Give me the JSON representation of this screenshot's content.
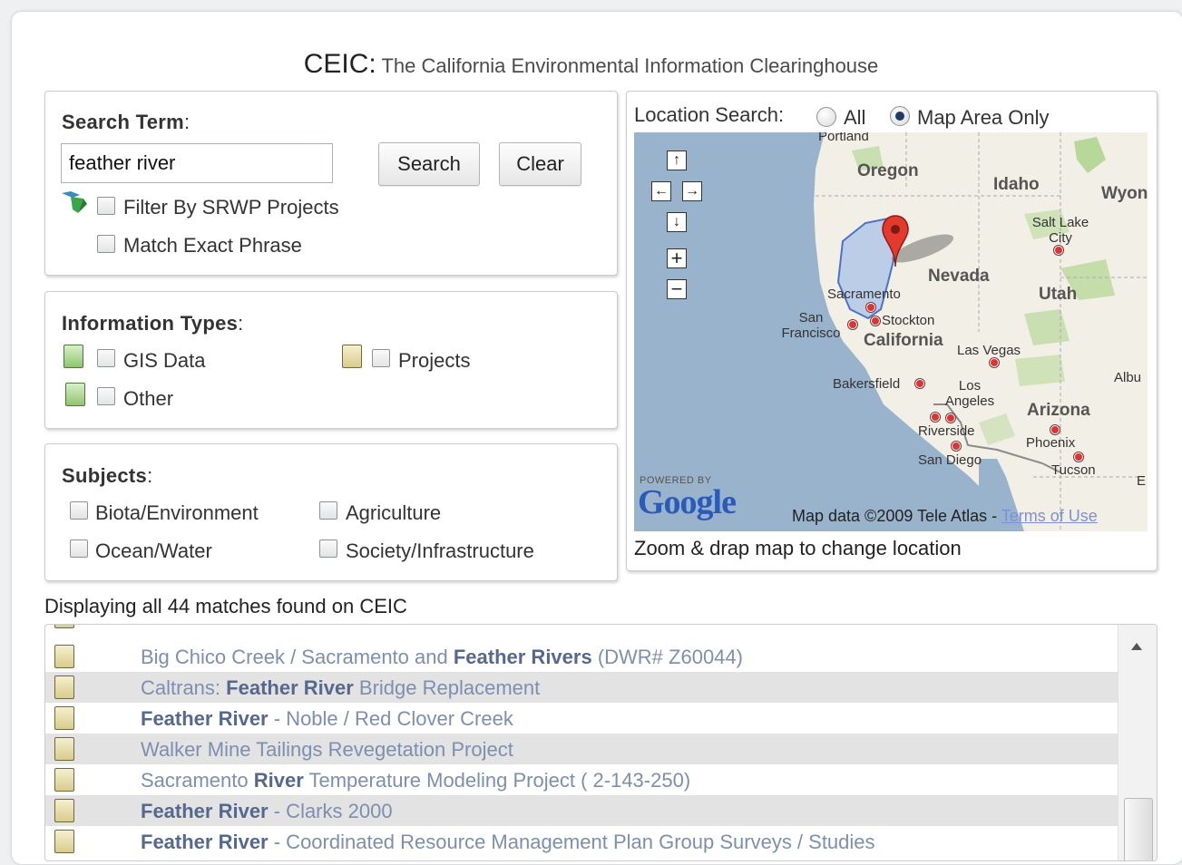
{
  "header": {
    "brand": "CEIC:",
    "subtitle": "The California Environmental Information Clearinghouse"
  },
  "search": {
    "heading": "Search Term",
    "value": "feather river",
    "search_button": "Search",
    "clear_button": "Clear",
    "filter_srwp_label": "Filter By SRWP Projects",
    "match_exact_label": "Match Exact Phrase"
  },
  "info_types": {
    "heading": "Information Types",
    "gis_label": "GIS Data",
    "projects_label": "Projects",
    "other_label": "Other"
  },
  "subjects": {
    "heading": "Subjects",
    "biota_label": "Biota/Environment",
    "agriculture_label": "Agriculture",
    "ocean_label": "Ocean/Water",
    "society_label": "Society/Infrastructure"
  },
  "location": {
    "label": "Location Search:",
    "all_label": "All",
    "map_area_label": "Map Area Only",
    "selected": "Map Area Only",
    "hint": "Zoom & drap map to change location"
  },
  "map": {
    "states": [
      "Oregon",
      "Idaho",
      "Wyon",
      "Nevada",
      "Utah",
      "California",
      "Arizona",
      "Albu"
    ],
    "cities": [
      "Portland",
      "Salt Lake City",
      "Sacramento",
      "Stockton",
      "San Francisco",
      "Las Vegas",
      "Bakersfield",
      "Los Angeles",
      "Riverside",
      "Phoenix",
      "San Diego",
      "Tucson",
      "E"
    ],
    "powered_by": "POWERED BY",
    "logo": "Google",
    "copyright": "Map data ©2009 Tele Atlas -",
    "terms_link": "Terms of Use",
    "colors": {
      "water": "#99b3cc",
      "land": "#f2efe6",
      "park": "#b8d89a",
      "watershed": "#6f93d8",
      "marker": "#e23a2d"
    }
  },
  "results": {
    "summary": "Displaying all 44 matches found on CEIC",
    "items": [
      {
        "pre": "Big Chico Creek / Sacramento and ",
        "bold": "Feather Rivers",
        "post": " (DWR# Z60044)"
      },
      {
        "pre": "Caltrans: ",
        "bold": "Feather River",
        "post": " Bridge Replacement"
      },
      {
        "pre": "",
        "bold": "Feather River",
        "post": " - Noble / Red Clover Creek"
      },
      {
        "pre": "Walker Mine Tailings Revegetation Project",
        "bold": "",
        "post": ""
      },
      {
        "pre": "Sacramento ",
        "bold": "River",
        "post": " Temperature Modeling Project ( 2-143-250)"
      },
      {
        "pre": "",
        "bold": "Feather River",
        "post": " - Clarks 2000"
      },
      {
        "pre": "",
        "bold": "Feather River",
        "post": " - Coordinated Resource Management Plan Group Surveys / Studies"
      }
    ]
  }
}
